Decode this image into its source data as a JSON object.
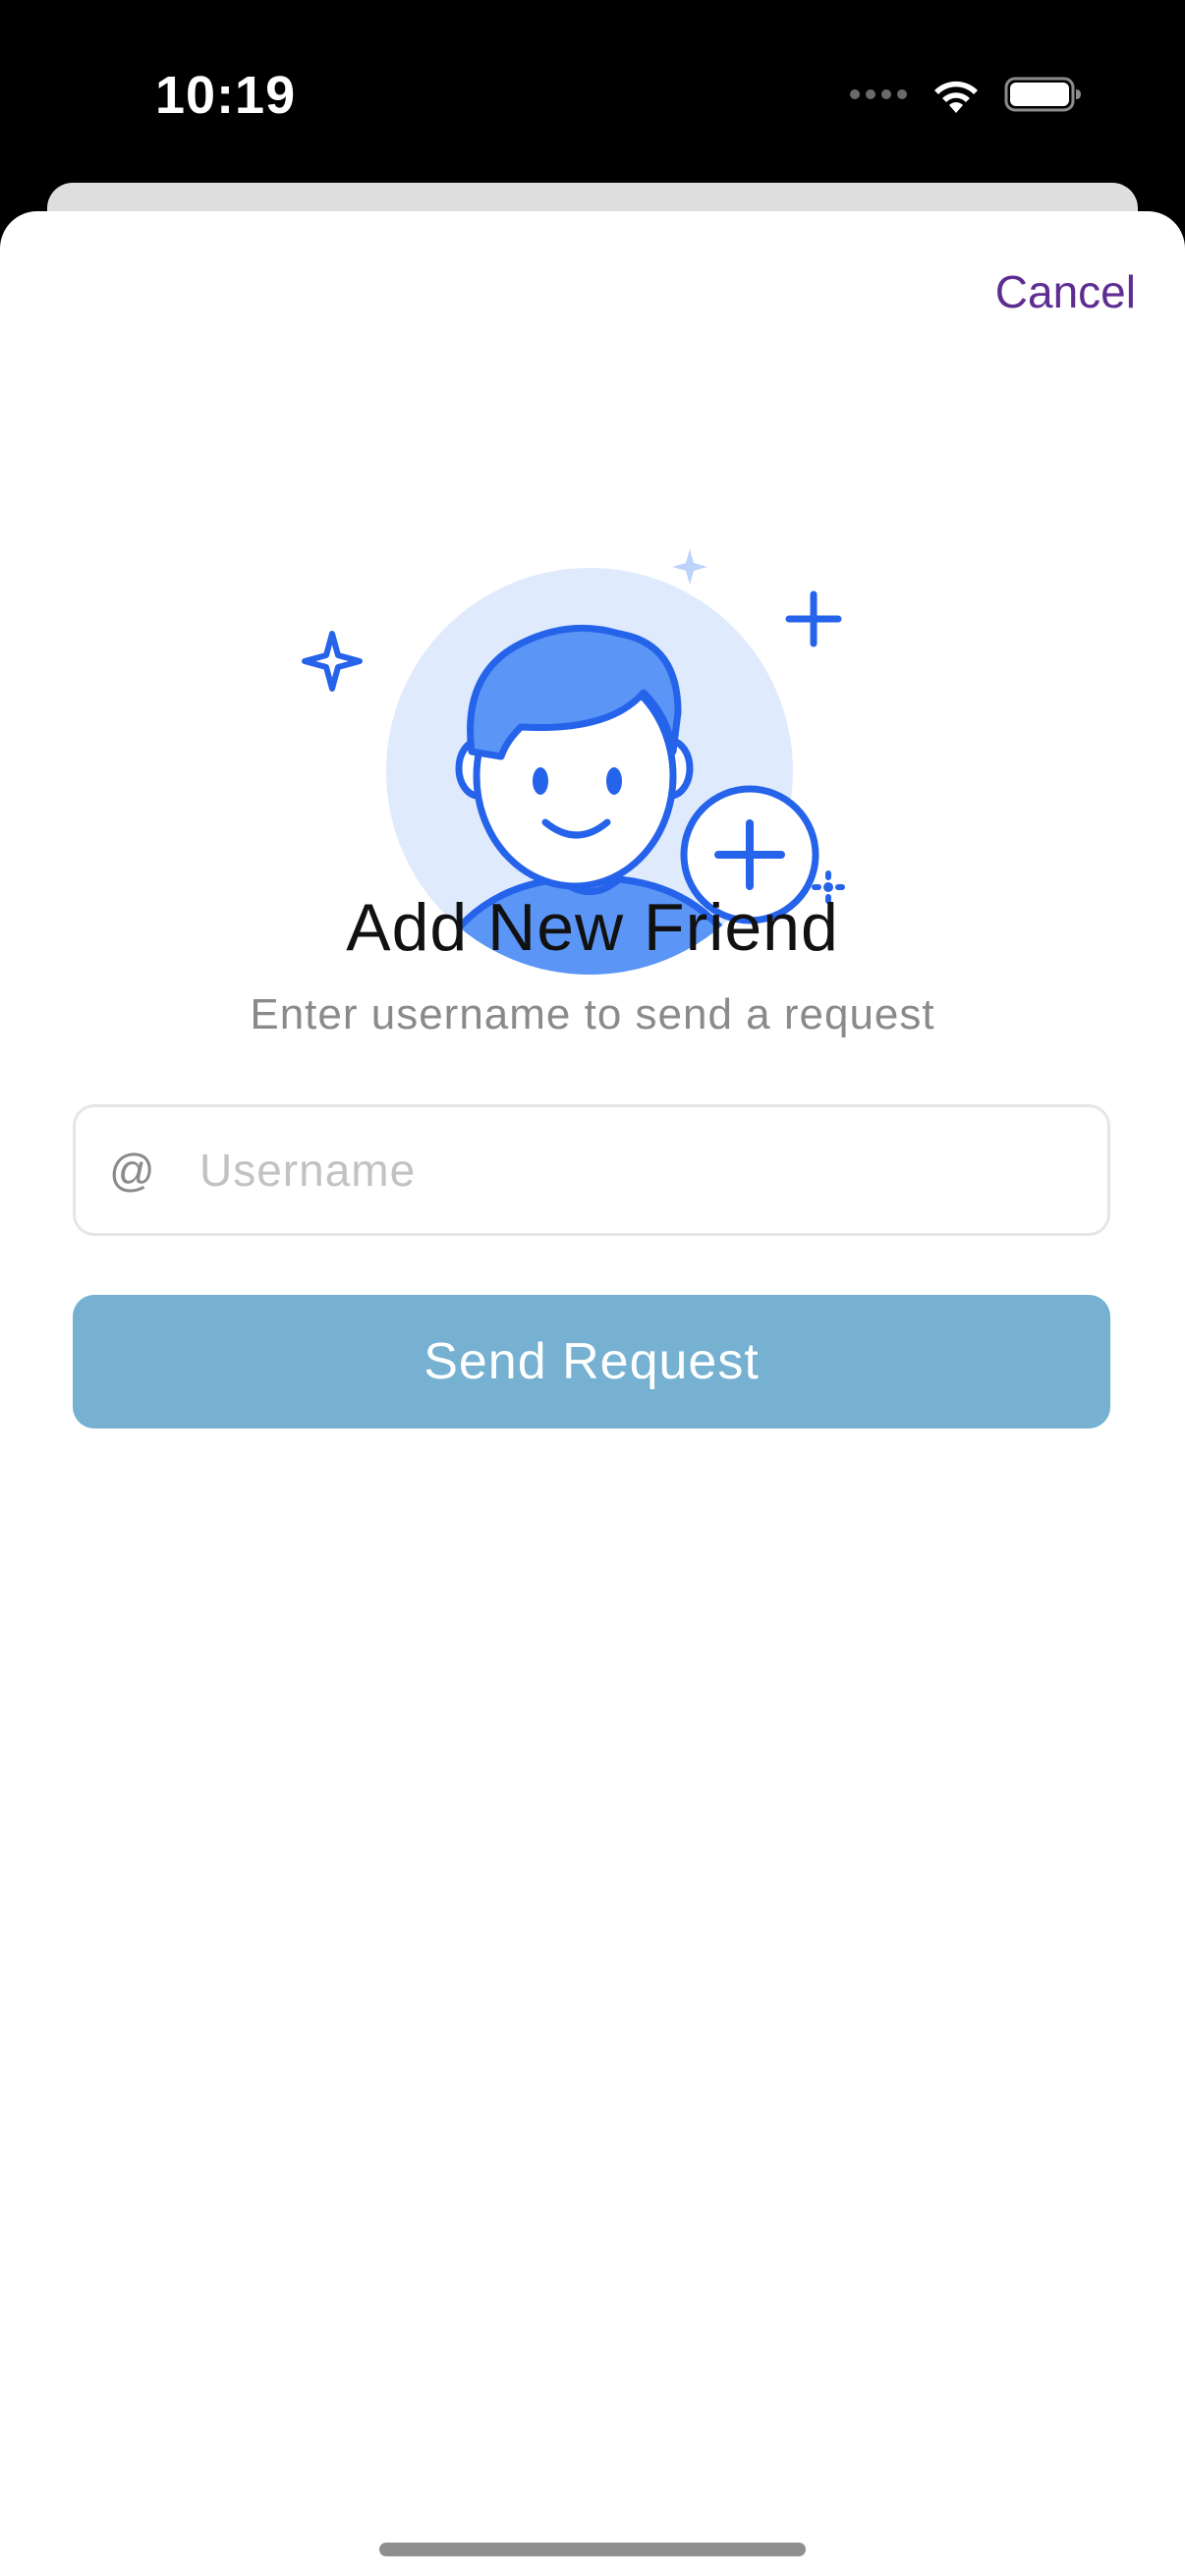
{
  "status_bar": {
    "time": "10:19"
  },
  "sheet": {
    "cancel_label": "Cancel",
    "title": "Add New Friend",
    "subtitle": "Enter username to send a request"
  },
  "form": {
    "prefix": "@",
    "username_placeholder": "Username",
    "username_value": "",
    "send_label": "Send Request"
  },
  "icons": {
    "illustration": "add-friend-illustration",
    "signal": "cellular-dots-icon",
    "wifi": "wifi-icon",
    "battery": "battery-icon"
  },
  "colors": {
    "accent": "#5e2d91",
    "button": "#76b1d1",
    "illustration_blue": "#2563eb",
    "illustration_light": "#dfeafd"
  }
}
